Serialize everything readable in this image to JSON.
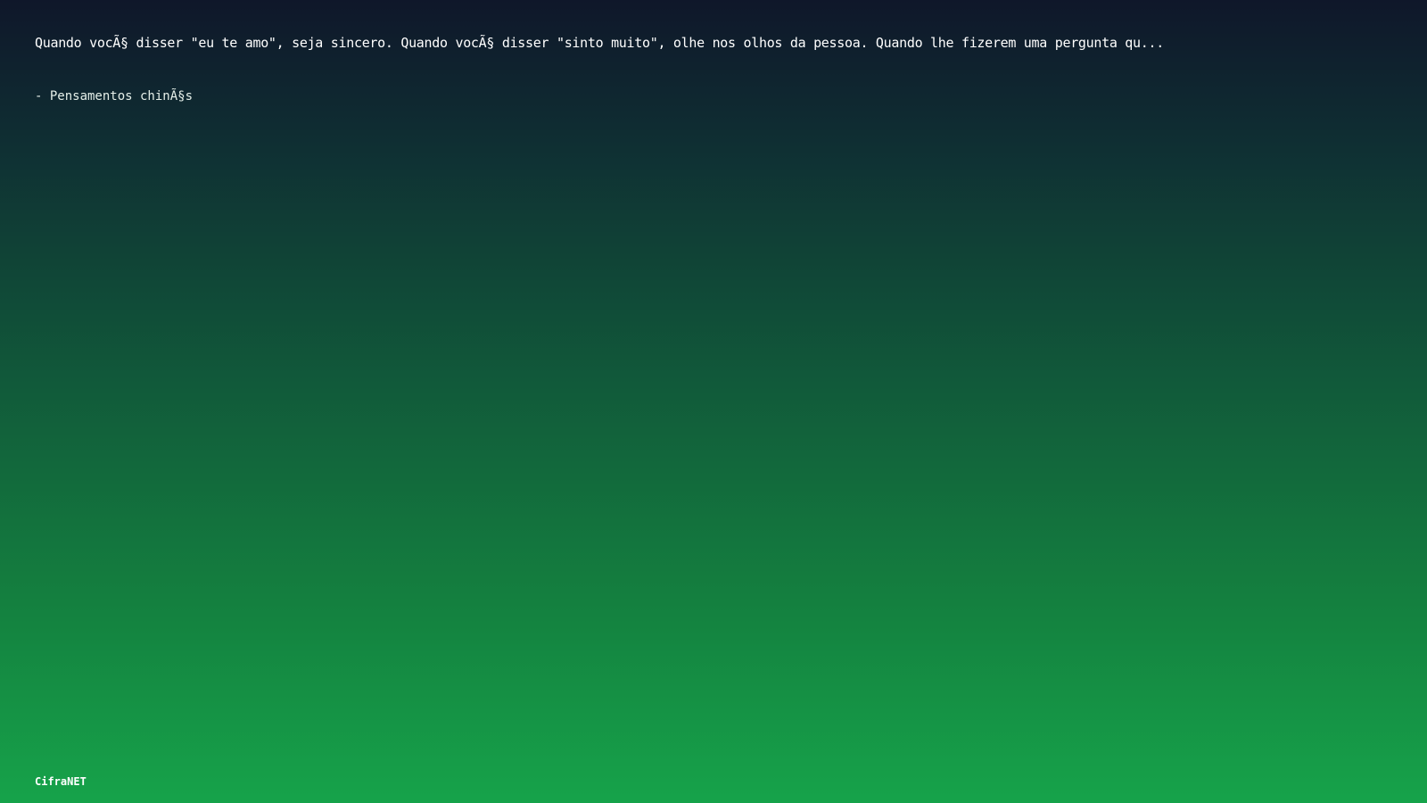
{
  "quote": {
    "text": "Quando vocÃ§ disser \"eu te amo\", seja sincero. Quando vocÃ§ disser \"sinto muito\", olhe nos olhos da pessoa. Quando lhe fizerem uma pergunta qu...",
    "author": "- Pensamentos chinÃ§s"
  },
  "brand": {
    "name": "CifraNET"
  },
  "colors": {
    "top": "#0f172a",
    "bottom": "#16a34a",
    "text": "#ffffff"
  }
}
